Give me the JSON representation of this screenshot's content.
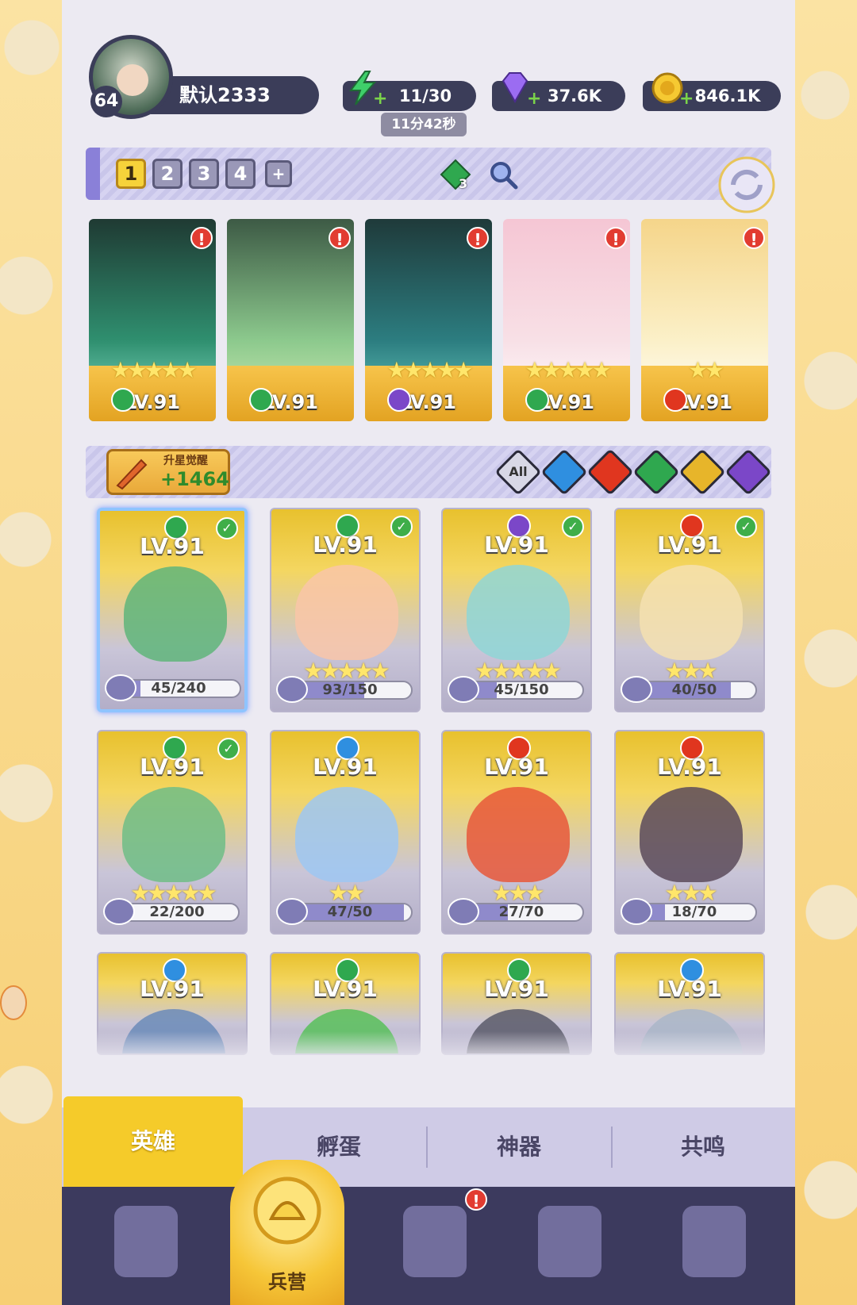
{
  "header": {
    "player_level": "64",
    "player_name": "默认2333",
    "energy": "11/30",
    "energy_timer": "11分42秒",
    "gems": "37.6K",
    "gold": "846.1K"
  },
  "team_bar": {
    "tabs": [
      "1",
      "2",
      "3",
      "4",
      "+"
    ],
    "active_tab": "1",
    "element_count": "3"
  },
  "team_cards": [
    {
      "level": "LV.91",
      "stars": "★★★★★",
      "element": "nature",
      "alert": "!"
    },
    {
      "level": "LV.91",
      "stars": "",
      "element": "nature",
      "alert": "!"
    },
    {
      "level": "LV.91",
      "stars": "★★★★★",
      "element": "dark",
      "alert": "!"
    },
    {
      "level": "LV.91",
      "stars": "★★★★★",
      "element": "nature",
      "alert": "!"
    },
    {
      "level": "LV.91",
      "stars": "★★",
      "element": "fire",
      "alert": "!"
    }
  ],
  "filter_bar": {
    "upgrade_label": "升星觉醒",
    "upgrade_value": "+1464",
    "filters": [
      "All",
      "water",
      "fire",
      "nature",
      "light",
      "dark"
    ]
  },
  "heroes": [
    {
      "level": "LV.91",
      "stars": "",
      "progress_text": "45/240",
      "progress": 0.19,
      "element": "nature",
      "check": true
    },
    {
      "level": "LV.91",
      "stars": "★★★★★",
      "progress_text": "93/150",
      "progress": 0.62,
      "element": "nature",
      "check": true
    },
    {
      "level": "LV.91",
      "stars": "★★★★★",
      "progress_text": "45/150",
      "progress": 0.3,
      "element": "dark",
      "check": true
    },
    {
      "level": "LV.91",
      "stars": "★★★",
      "progress_text": "40/50",
      "progress": 0.8,
      "element": "fire",
      "check": true
    },
    {
      "level": "LV.91",
      "stars": "★★★★★",
      "progress_text": "22/200",
      "progress": 0.11,
      "element": "nature",
      "check": true
    },
    {
      "level": "LV.91",
      "stars": "★★",
      "progress_text": "47/50",
      "progress": 0.94,
      "element": "water",
      "check": false
    },
    {
      "level": "LV.91",
      "stars": "★★★",
      "progress_text": "27/70",
      "progress": 0.39,
      "element": "fire",
      "check": false
    },
    {
      "level": "LV.91",
      "stars": "★★★",
      "progress_text": "18/70",
      "progress": 0.26,
      "element": "fire",
      "check": false
    },
    {
      "level": "LV.91",
      "stars": "",
      "progress_text": "",
      "progress": 0,
      "element": "water",
      "check": false
    },
    {
      "level": "LV.91",
      "stars": "",
      "progress_text": "",
      "progress": 0,
      "element": "nature",
      "check": false
    },
    {
      "level": "LV.91",
      "stars": "",
      "progress_text": "",
      "progress": 0,
      "element": "nature",
      "check": false
    },
    {
      "level": "LV.91",
      "stars": "",
      "progress_text": "",
      "progress": 0,
      "element": "water",
      "check": false
    }
  ],
  "sub_tabs": [
    "英雄",
    "孵蛋",
    "神器",
    "共鸣"
  ],
  "bottom_nav": {
    "active_label": "兵营",
    "items": [
      "cards-icon",
      "barracks-icon",
      "map-icon",
      "temple-icon",
      "mushroom-icon"
    ],
    "alert": "!"
  },
  "colors": {
    "nature": "#2fa84f",
    "dark": "#7b47c8",
    "fire": "#e0361f",
    "water": "#2f8fe0",
    "light": "#e7b52a",
    "accent": "#f5cb2a"
  }
}
